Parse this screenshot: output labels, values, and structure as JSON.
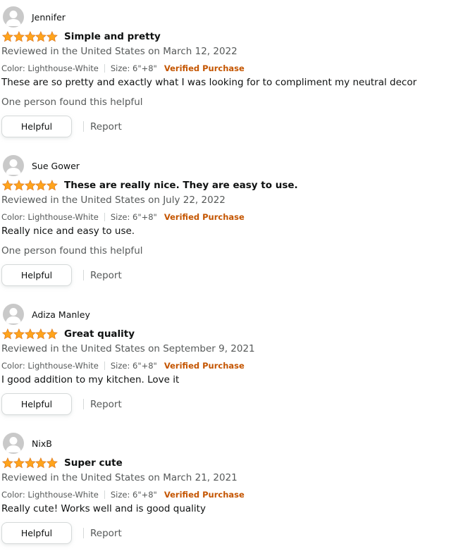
{
  "colors": {
    "star": "#ffa41c",
    "star_outline": "#de7921",
    "verified": "#c45500",
    "secondary_text": "#565959",
    "primary_text": "#0f1111",
    "avatar_bg": "#c9c9c9"
  },
  "icons": {
    "avatar": "default-user-avatar-icon",
    "star": "filled-star-icon"
  },
  "reviews": [
    {
      "author": "Jennifer",
      "rating": 5,
      "title": "Simple and pretty",
      "date": "Reviewed in the United States on March 12, 2022",
      "color": "Color: Lighthouse-White",
      "size": "Size: 6\"+8\"",
      "verified": "Verified Purchase",
      "body": "These are so pretty and exactly what I was looking for to compliment my neutral decor",
      "helpful_count": "One person found this helpful",
      "helpful_label": "Helpful",
      "report_label": "Report"
    },
    {
      "author": "Sue Gower",
      "rating": 5,
      "title": "These are really nice. They are easy to use.",
      "date": "Reviewed in the United States on July 22, 2022",
      "color": "Color: Lighthouse-White",
      "size": "Size: 6\"+8\"",
      "verified": "Verified Purchase",
      "body": "Really nice and easy to use.",
      "helpful_count": "One person found this helpful",
      "helpful_label": "Helpful",
      "report_label": "Report"
    },
    {
      "author": "Adiza Manley",
      "rating": 5,
      "title": "Great quality",
      "date": "Reviewed in the United States on September 9, 2021",
      "color": "Color: Lighthouse-White",
      "size": "Size: 6\"+8\"",
      "verified": "Verified Purchase",
      "body": "I good addition to my kitchen. Love it",
      "helpful_label": "Helpful",
      "report_label": "Report"
    },
    {
      "author": "NixB",
      "rating": 5,
      "title": "Super cute",
      "date": "Reviewed in the United States on March 21, 2021",
      "color": "Color: Lighthouse-White",
      "size": "Size: 6\"+8\"",
      "verified": "Verified Purchase",
      "body": "Really cute! Works well and is good quality",
      "helpful_label": "Helpful",
      "report_label": "Report"
    }
  ]
}
